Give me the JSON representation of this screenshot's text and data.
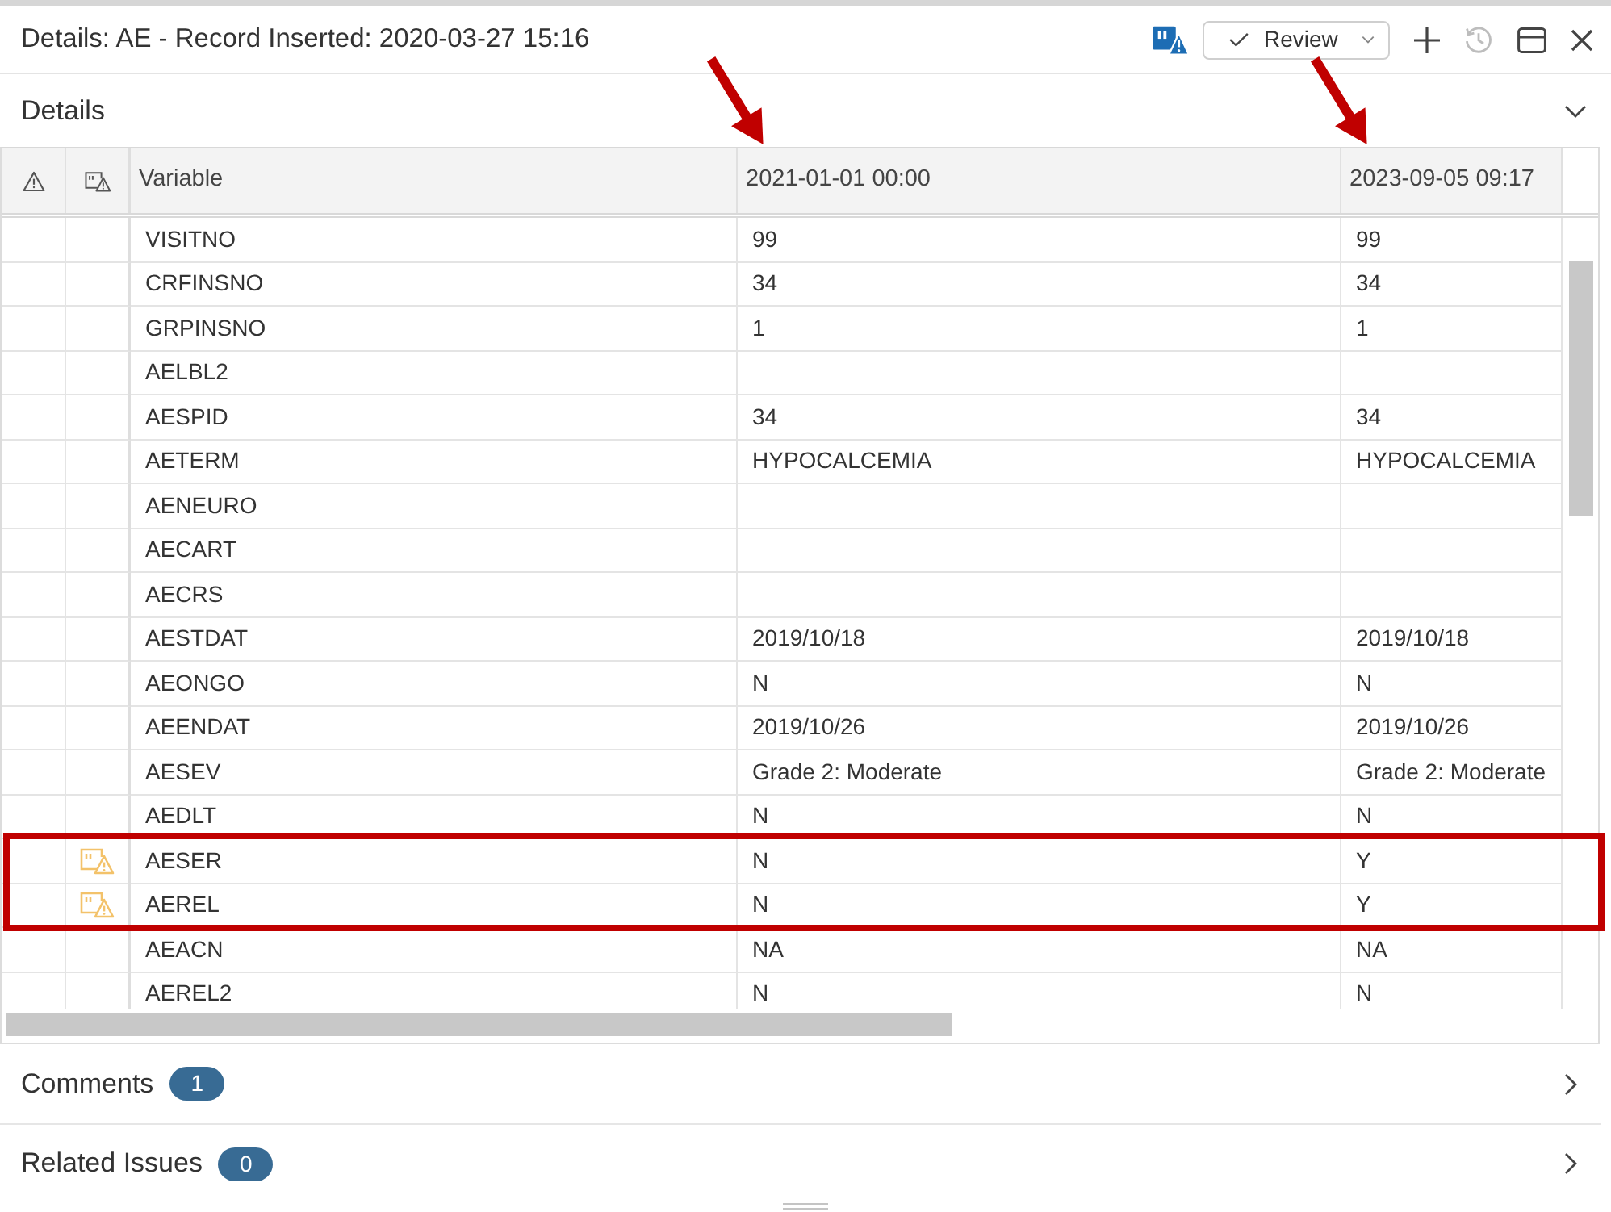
{
  "window": {
    "title": "Details: AE - Record Inserted: 2020-03-27 15:16",
    "review_button": {
      "label": "Review"
    },
    "toolbar": [
      {
        "kind": "add",
        "disabled": false
      },
      {
        "kind": "history",
        "disabled": true
      },
      {
        "kind": "layout",
        "disabled": false
      },
      {
        "kind": "close",
        "disabled": false
      }
    ]
  },
  "details": {
    "title": "Details",
    "expanded": true,
    "table": {
      "columns": [
        {
          "label": "Variable",
          "arrow": false
        },
        {
          "label": "2021-01-01 00:00",
          "arrow": true
        },
        {
          "label": "2023-09-05 09:17",
          "arrow": true
        }
      ],
      "rows": [
        {
          "variable": "VISITNO",
          "values": [
            "99",
            "99"
          ],
          "flagged": false,
          "highlighted": false
        },
        {
          "variable": "CRFINSNO",
          "values": [
            "34",
            "34"
          ],
          "flagged": false,
          "highlighted": false
        },
        {
          "variable": "GRPINSNO",
          "values": [
            "1",
            "1"
          ],
          "flagged": false,
          "highlighted": false
        },
        {
          "variable": "AELBL2",
          "flagged": false,
          "highlighted": false
        },
        {
          "variable": "AESPID",
          "values": [
            "34",
            "34"
          ],
          "flagged": false,
          "highlighted": false
        },
        {
          "variable": "AETERM",
          "values": [
            "HYPOCALCEMIA",
            "HYPOCALCEMIA"
          ],
          "flagged": false,
          "highlighted": false
        },
        {
          "variable": "AENEURO",
          "flagged": false,
          "highlighted": false
        },
        {
          "variable": "AECART",
          "flagged": false,
          "highlighted": false
        },
        {
          "variable": "AECRS",
          "flagged": false,
          "highlighted": false
        },
        {
          "variable": "AESTDAT",
          "values": [
            "2019/10/18",
            "2019/10/18"
          ],
          "flagged": false,
          "highlighted": false
        },
        {
          "variable": "AEONGO",
          "values": [
            "N",
            "N"
          ],
          "flagged": false,
          "highlighted": false
        },
        {
          "variable": "AEENDAT",
          "values": [
            "2019/10/26",
            "2019/10/26"
          ],
          "flagged": false,
          "highlighted": false
        },
        {
          "variable": "AESEV",
          "values": [
            "Grade 2: Moderate",
            "Grade 2: Moderate"
          ],
          "flagged": false,
          "highlighted": false
        },
        {
          "variable": "AEDLT",
          "values": [
            "N",
            "N"
          ],
          "flagged": false,
          "highlighted": false
        },
        {
          "variable": "AESER",
          "values": [
            "N",
            "Y"
          ],
          "flagged": true,
          "highlighted": true
        },
        {
          "variable": "AEREL",
          "values": [
            "N",
            "Y"
          ],
          "flagged": true,
          "highlighted": true
        },
        {
          "variable": "AEACN",
          "values": [
            "NA",
            "NA"
          ],
          "flagged": false,
          "highlighted": false
        },
        {
          "variable": "AEREL2",
          "values": [
            "N",
            "N"
          ],
          "flagged": false,
          "highlighted": false
        }
      ]
    }
  },
  "sections": [
    {
      "title": "Comments",
      "count": "1",
      "expanded": false
    },
    {
      "title": "Related Issues",
      "count": "0",
      "expanded": false
    }
  ]
}
